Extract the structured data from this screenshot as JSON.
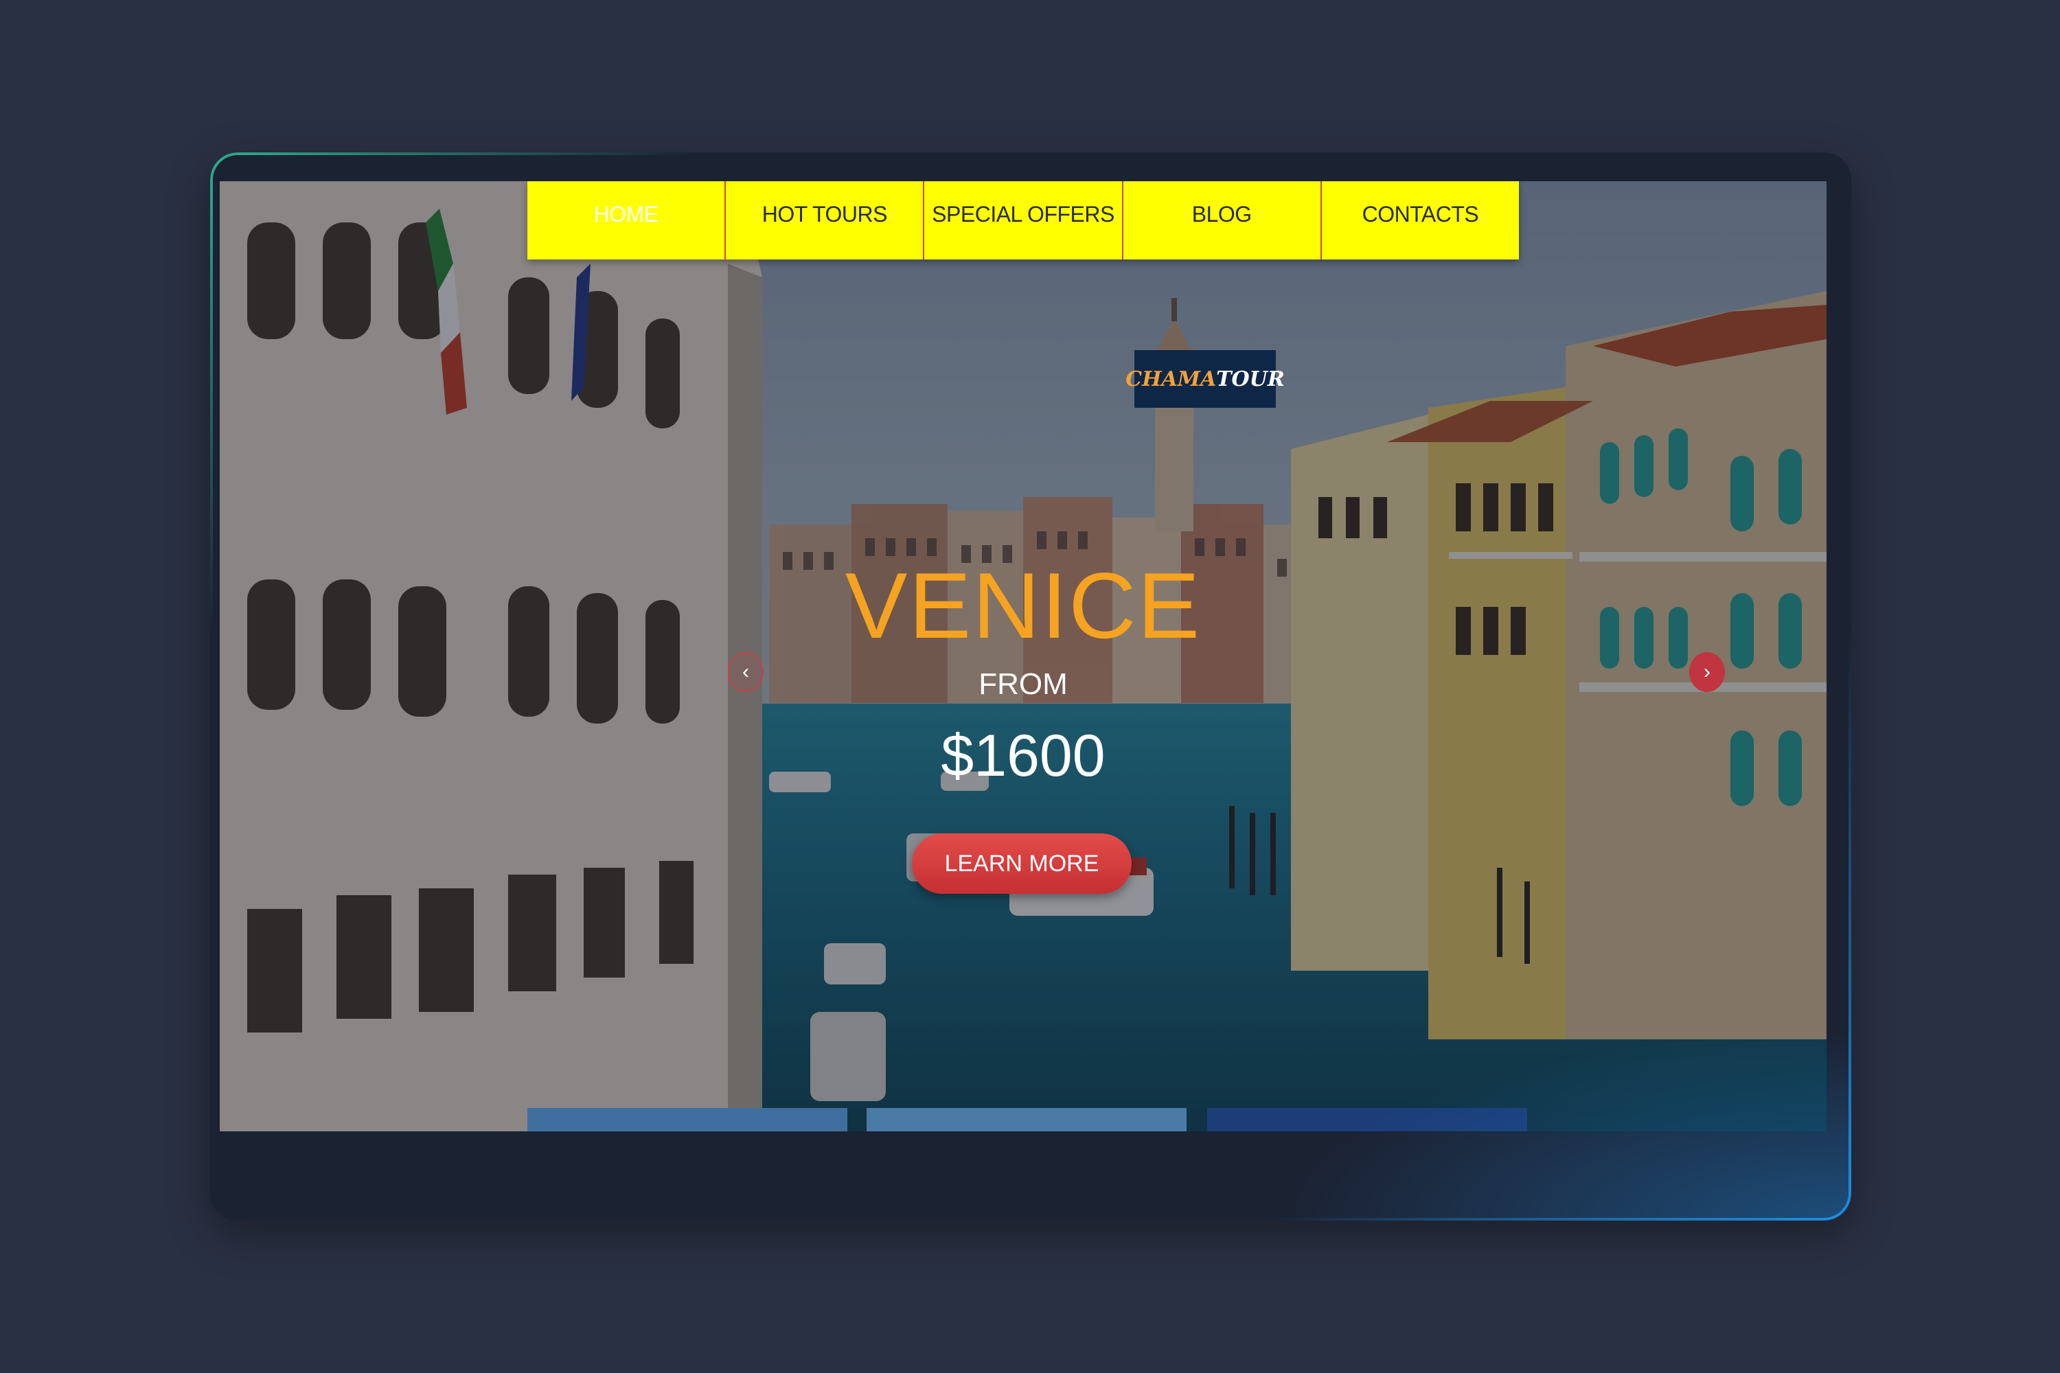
{
  "nav": {
    "items": [
      {
        "label": "HOME",
        "active": true
      },
      {
        "label": "HOT TOURS",
        "active": false
      },
      {
        "label": "SPECIAL OFFERS",
        "active": false
      },
      {
        "label": "BLOG",
        "active": false
      },
      {
        "label": "CONTACTS",
        "active": false
      }
    ]
  },
  "logo": {
    "part1": "CHAMA",
    "part2": "TOUR"
  },
  "hero": {
    "title": "VENICE",
    "from_label": "FROM",
    "price": "$1600",
    "cta_label": "LEARN MORE"
  },
  "slider": {
    "prev_icon": "chevron-left-icon",
    "next_icon": "chevron-right-icon",
    "prev_glyph": "‹",
    "next_glyph": "›"
  },
  "colors": {
    "nav_bg": "#ffff00",
    "title": "#f5a321",
    "cta": "#d63c3c",
    "page_bg": "#2a3043"
  }
}
